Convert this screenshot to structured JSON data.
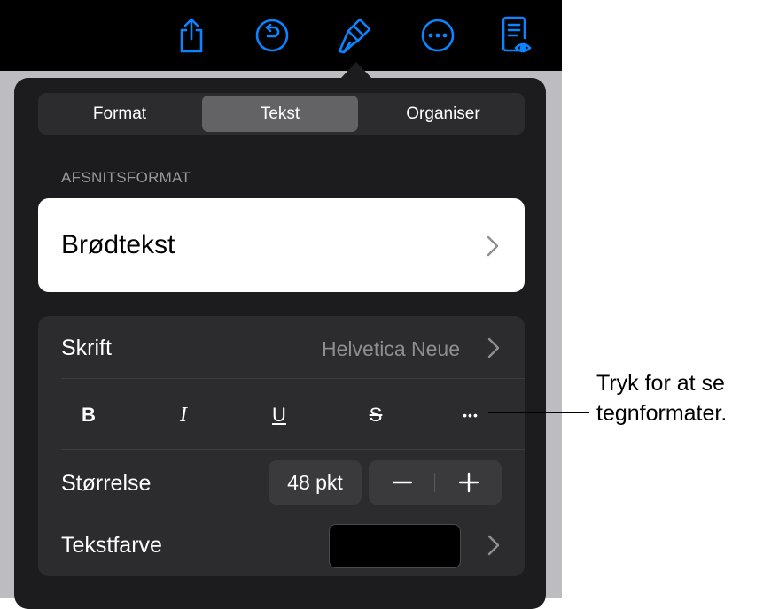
{
  "toolbar": {
    "icons": [
      "share-icon",
      "undo-icon",
      "format-brush-icon",
      "more-icon",
      "reader-view-icon"
    ],
    "accent": "#0a84ff"
  },
  "tabs": [
    {
      "label": "Format",
      "active": false
    },
    {
      "label": "Tekst",
      "active": true
    },
    {
      "label": "Organiser",
      "active": false
    }
  ],
  "paragraph_style": {
    "section_title": "AFSNITSFORMAT",
    "value": "Brødtekst"
  },
  "font_row": {
    "label": "Skrift",
    "value": "Helvetica Neue"
  },
  "format_buttons": {
    "bold": "B",
    "italic": "I",
    "underline": "U",
    "strikethrough": "S",
    "more": "•••"
  },
  "size_row": {
    "label": "Størrelse",
    "value": "48 pkt",
    "minus": "−",
    "plus": "+"
  },
  "color_row": {
    "label": "Tekstfarve",
    "swatch_color": "#000000"
  },
  "callout": {
    "line1": "Tryk for at se",
    "line2": "tegnformater."
  }
}
